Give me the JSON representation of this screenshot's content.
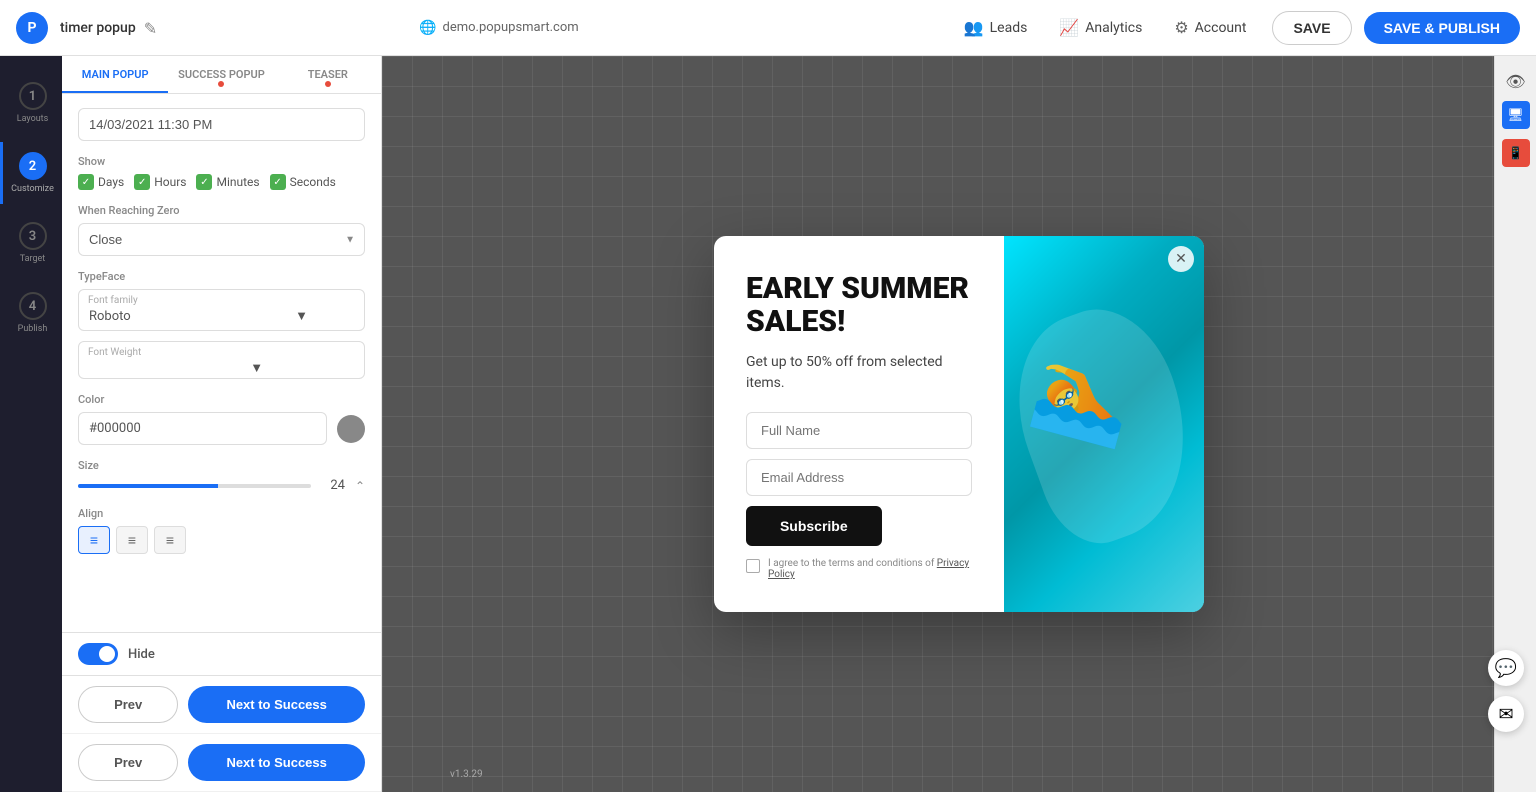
{
  "topbar": {
    "logo_text": "P",
    "project_name": "timer popup",
    "url": "demo.popupsmart.com",
    "leads_label": "Leads",
    "analytics_label": "Analytics",
    "account_label": "Account",
    "save_label": "SAVE",
    "save_publish_label": "SAVE & PUBLISH"
  },
  "steps": [
    {
      "number": "1",
      "label": "Layouts",
      "active": false
    },
    {
      "number": "2",
      "label": "Customize",
      "active": true
    },
    {
      "number": "3",
      "label": "Target",
      "active": false
    },
    {
      "number": "4",
      "label": "Publish",
      "active": false
    }
  ],
  "panel": {
    "tabs": [
      {
        "label": "MAIN POPUP",
        "active": true,
        "dot_color": "blue"
      },
      {
        "label": "SUCCESS POPUP",
        "active": false,
        "dot_color": "red"
      },
      {
        "label": "TEASER",
        "active": false,
        "dot_color": "red"
      }
    ],
    "date_value": "14/03/2021 11:30 PM",
    "show_label": "Show",
    "show_items": [
      {
        "label": "Days",
        "checked": true
      },
      {
        "label": "Hours",
        "checked": true
      },
      {
        "label": "Minutes",
        "checked": true
      },
      {
        "label": "Seconds",
        "checked": true
      }
    ],
    "when_reaching_zero_label": "When Reaching Zero",
    "when_reaching_zero_value": "Close",
    "typeface_label": "TypeFace",
    "font_family_label": "Font family",
    "font_family_value": "Roboto",
    "font_weight_label": "Font Weight",
    "font_weight_value": "",
    "color_label": "Color",
    "color_value": "#000000",
    "size_label": "Size",
    "size_number": "24",
    "align_label": "Align",
    "align_options": [
      "left",
      "center",
      "right"
    ],
    "hide_label": "Hide",
    "hide_toggle": true,
    "footer_rows": [
      {
        "prev_label": "Prev",
        "next_label": "Next to Success"
      },
      {
        "prev_label": "Prev",
        "next_label": "Next to Success"
      }
    ]
  },
  "popup": {
    "title": "EARLY SUMMER SALES!",
    "subtitle": "Get up to 50% off from selected items.",
    "full_name_placeholder": "Full Name",
    "email_placeholder": "Email Address",
    "subscribe_label": "Subscribe",
    "privacy_text": "I agree to the terms and conditions of ",
    "privacy_link": "Privacy Policy"
  },
  "version": "v1.3.29"
}
